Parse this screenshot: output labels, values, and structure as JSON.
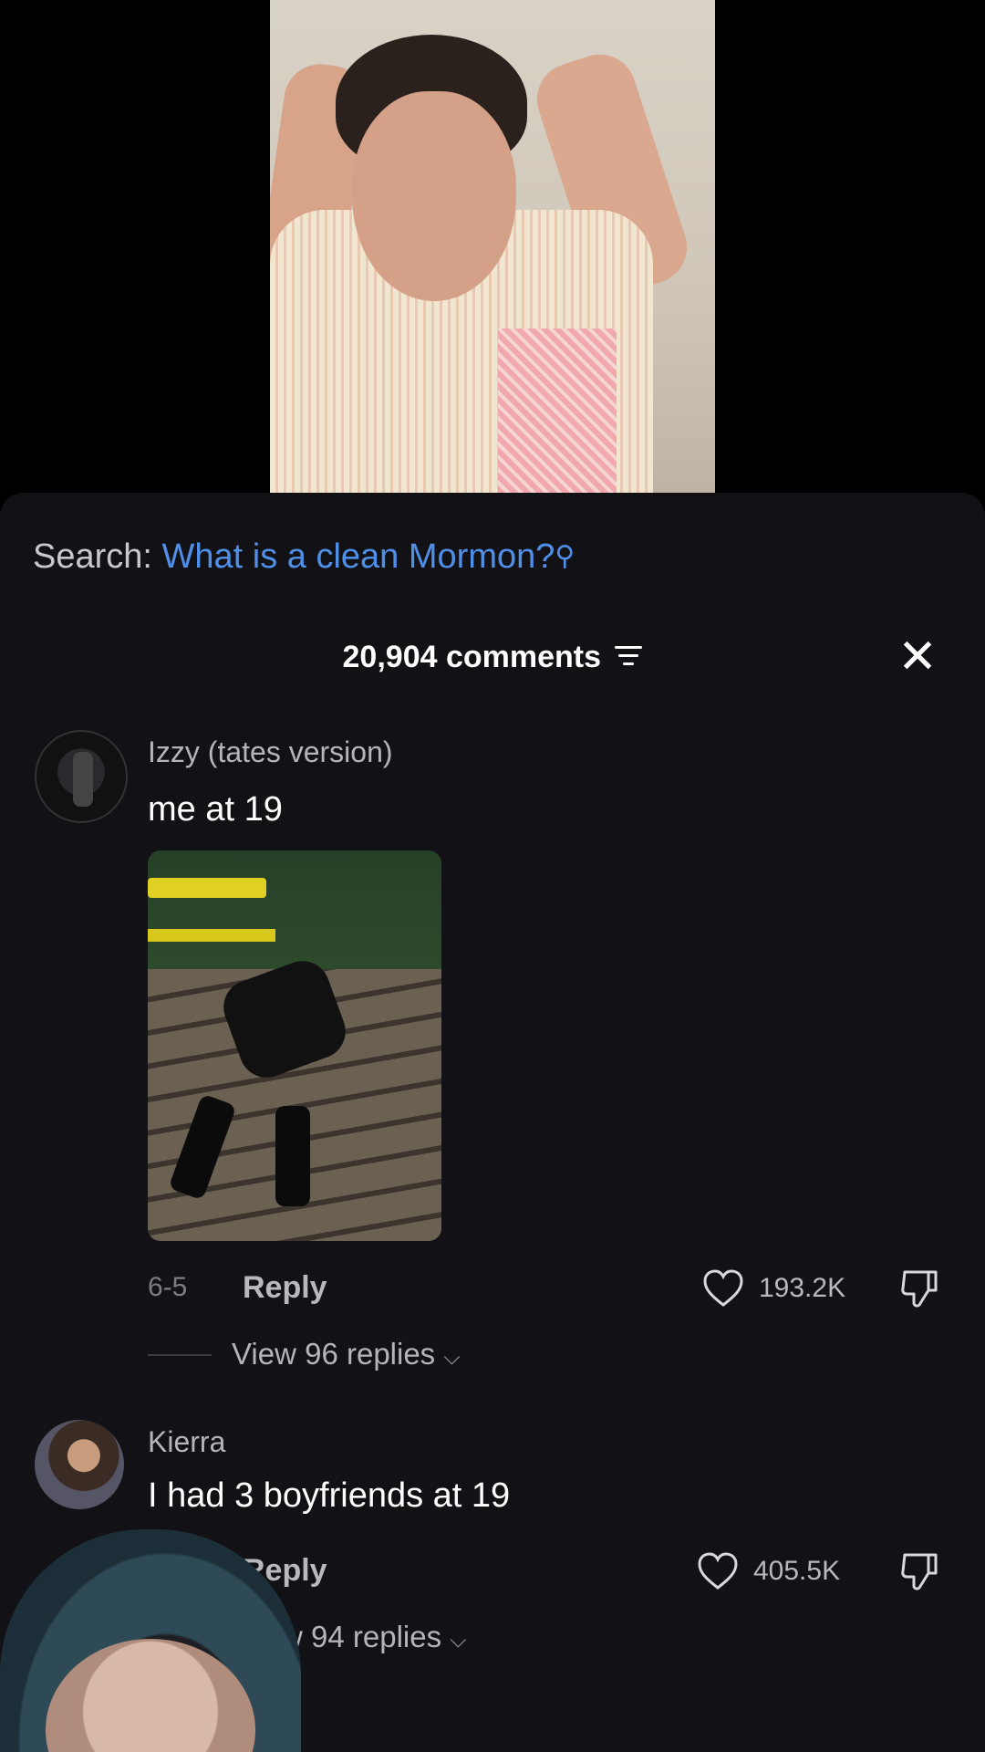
{
  "search": {
    "label": "Search:",
    "query": "What is a clean Mormon?",
    "icon": "search-icon"
  },
  "comments_header": {
    "count_text": "20,904 comments",
    "filter_icon": "filter-icon",
    "close_icon": "close-icon",
    "close_glyph": "✕"
  },
  "comments": [
    {
      "username": "Izzy (tates version)",
      "text": "me at 19",
      "has_image": true,
      "date": "6-5",
      "reply_label": "Reply",
      "likes": "193.2K",
      "view_replies": "View 96 replies"
    },
    {
      "username": "Kierra",
      "text": "I had 3 boyfriends at 19",
      "has_image": false,
      "reply_label": "Reply",
      "likes": "405.5K",
      "view_replies": "w 94 replies"
    }
  ],
  "colors": {
    "panel_bg": "#121216",
    "search_link": "#4f8fe8",
    "muted_text": "#b4b4ba"
  }
}
